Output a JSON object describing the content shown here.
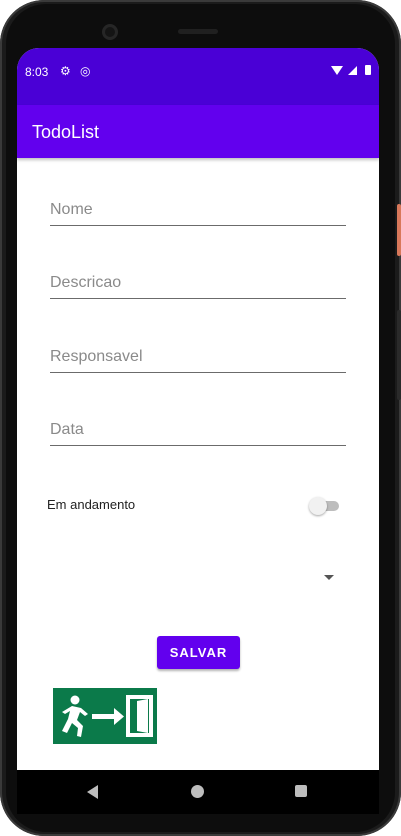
{
  "status_bar": {
    "time": "8:03",
    "icons": [
      "gear-icon",
      "do-not-disturb-icon",
      "wifi-icon",
      "cell-signal-icon",
      "battery-icon"
    ]
  },
  "app_bar": {
    "title": "TodoList"
  },
  "form": {
    "nome_placeholder": "Nome",
    "descricao_placeholder": "Descricao",
    "responsavel_placeholder": "Responsavel",
    "data_placeholder": "Data",
    "switch_label": "Em andamento",
    "switch_on": false,
    "spinner_selected": ""
  },
  "actions": {
    "save_label": "SALVAR"
  },
  "image": {
    "name": "exit-sign-icon"
  },
  "colors": {
    "status_bar": "#4a00d6",
    "primary": "#6200ee",
    "exit_sign_green": "#0b7a4a"
  },
  "nav_bar": {
    "icons": [
      "back-icon",
      "home-icon",
      "recents-icon"
    ]
  }
}
